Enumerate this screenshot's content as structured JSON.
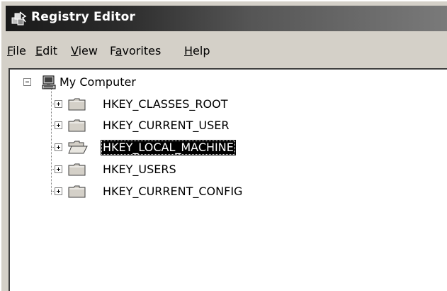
{
  "window": {
    "title": "Registry Editor",
    "title_icon": "registry-editor-icon"
  },
  "menu": {
    "items": [
      {
        "label": "File",
        "accel": "F",
        "rest": "ile"
      },
      {
        "label": "Edit",
        "accel": "E",
        "rest": "dit"
      },
      {
        "label": "View",
        "accel": "V",
        "rest": "iew"
      },
      {
        "label": "Favorites",
        "pre": "F",
        "accel": "a",
        "rest": "vorites"
      },
      {
        "label": "Help",
        "accel": "H",
        "rest": "elp"
      }
    ]
  },
  "tree": {
    "root": {
      "label": "My Computer",
      "icon": "computer-icon",
      "expanded": true
    },
    "keys": [
      {
        "label": "HKEY_CLASSES_ROOT",
        "icon": "folder-icon",
        "selected": false
      },
      {
        "label": "HKEY_CURRENT_USER",
        "icon": "folder-icon",
        "selected": false
      },
      {
        "label": "HKEY_LOCAL_MACHINE",
        "icon": "open-folder-icon",
        "selected": true
      },
      {
        "label": "HKEY_USERS",
        "icon": "folder-icon",
        "selected": false
      },
      {
        "label": "HKEY_CURRENT_CONFIG",
        "icon": "folder-icon",
        "selected": false
      }
    ]
  },
  "colors": {
    "titlebar_start": "#1a1a1a",
    "titlebar_end": "#7a7a7a",
    "face": "#d4d0c8",
    "selection": "#000000"
  }
}
